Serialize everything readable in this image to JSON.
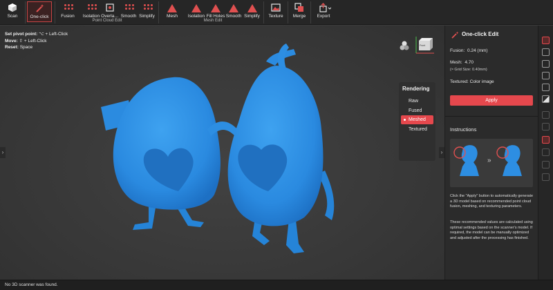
{
  "toolbar": {
    "scan_label": "Scan",
    "one_click_label": "One-click",
    "point_cloud": {
      "group_label": "Point Cloud Edit",
      "items": [
        "Fusion",
        "Isolation",
        "Overla…",
        "Smooth",
        "Simplify"
      ]
    },
    "mesh": {
      "group_label": "Mesh Edit",
      "items": [
        "Mesh",
        "Isolation",
        "Fill Holes",
        "Smooth",
        "Simplify"
      ]
    },
    "texture_label": "Texture",
    "merge_label": "Merge",
    "export_label": "Export"
  },
  "hints": {
    "pivot_key": "Set pivot point:",
    "pivot_val": "⌥ + Left-Click",
    "move_key": "Move:",
    "move_val": "⇧ + Left-Click",
    "reset_key": "Reset:",
    "reset_val": "Space"
  },
  "rendering": {
    "title": "Rendering",
    "options": [
      "Raw",
      "Fused",
      "Meshed",
      "Textured"
    ],
    "selected": "Meshed"
  },
  "panel": {
    "title": "One-click Edit",
    "fusion_label": "Fusion:",
    "fusion_value": "0.24 (mm)",
    "mesh_label": "Mesh:",
    "mesh_value": "4.70",
    "grid_note": "(≈ Grid Size: 0.40mm)",
    "textured_label": "Textured:",
    "textured_value": "Color image",
    "apply_label": "Apply",
    "instructions_title": "Instructions",
    "arrow_glyph": "»",
    "desc1": "Click the \"Apply\" button to automatically generate a 3D model based on recommended point cloud fusion, meshing, and texturing parameters.",
    "desc2": "These recommended values are calculated using optimal settings based on the scanner's model. If required, the model can be manually optimized and adjusted after the processing has finished."
  },
  "viewcube": {
    "face_label": "Front"
  },
  "status": {
    "message": "No 3D scanner was found."
  },
  "colors": {
    "accent": "#e5484d",
    "model": "#2f8fe0"
  }
}
